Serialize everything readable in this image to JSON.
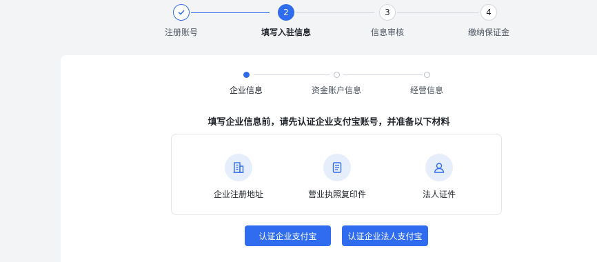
{
  "steps": [
    {
      "number": "",
      "label": "注册账号",
      "state": "done",
      "icon": "check-icon"
    },
    {
      "number": "2",
      "label": "填写入驻信息",
      "state": "active"
    },
    {
      "number": "3",
      "label": "信息审核",
      "state": "todo"
    },
    {
      "number": "4",
      "label": "缴纳保证金",
      "state": "todo"
    }
  ],
  "substeps": [
    {
      "label": "企业信息",
      "state": "active"
    },
    {
      "label": "资金账户信息",
      "state": "todo"
    },
    {
      "label": "经营信息",
      "state": "todo"
    }
  ],
  "headline": "填写企业信息前，请先认证企业支付宝账号，并准备以下材料",
  "materials": [
    {
      "label": "企业注册地址",
      "icon": "building-icon"
    },
    {
      "label": "营业执照复印件",
      "icon": "document-icon"
    },
    {
      "label": "法人证件",
      "icon": "person-icon"
    }
  ],
  "buttons": {
    "verify_alipay": "认证企业支付宝",
    "verify_legal_alipay": "认证企业法人支付宝"
  },
  "colors": {
    "accent": "#2f6cf0",
    "icon_bg": "#e6eefc",
    "page_bg": "#f3f4f6",
    "line": "#d4d7dd"
  }
}
